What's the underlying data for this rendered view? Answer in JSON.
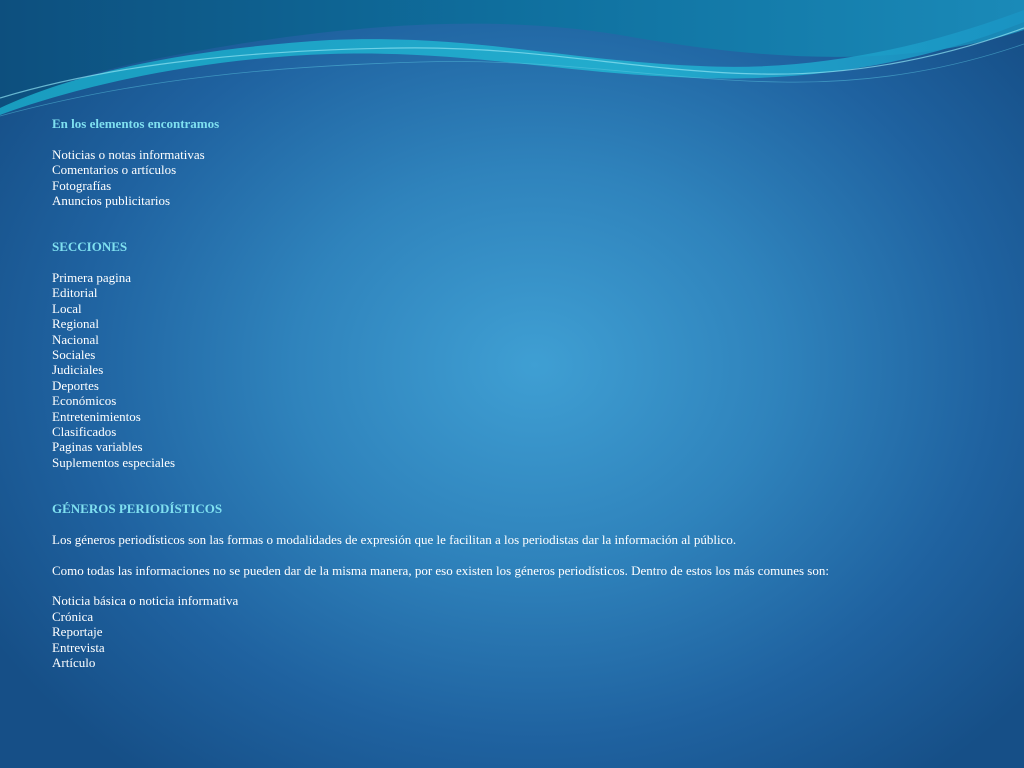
{
  "colors": {
    "background_center": "#3f9fd3",
    "background_edge": "#164f87",
    "heading": "#7fe0f0",
    "body_text": "#ffffff",
    "wave_light": "#1fa5c9",
    "wave_dark": "#0f5f8c"
  },
  "section1": {
    "heading": "En los elementos encontramos",
    "items": [
      "Noticias o notas informativas",
      "Comentarios o artículos",
      "Fotografías",
      "Anuncios publicitarios"
    ]
  },
  "section2": {
    "heading": "SECCIONES",
    "items": [
      "Primera pagina",
      "Editorial",
      "Local",
      "Regional",
      "Nacional",
      "Sociales",
      "Judiciales",
      "Deportes",
      "Económicos",
      "Entretenimientos",
      "Clasificados",
      "Paginas variables",
      "Suplementos especiales"
    ]
  },
  "section3": {
    "heading": "GÉNEROS PERIODÍSTICOS",
    "paragraph1": "Los géneros periodísticos son las formas o modalidades de expresión que le facilitan a los periodistas dar la información al público.",
    "paragraph2": "Como todas las informaciones no se pueden dar de la misma manera, por eso existen los géneros periodísticos. Dentro de estos los más comunes son:",
    "items": [
      "Noticia básica o noticia informativa",
      "Crónica",
      "Reportaje",
      "Entrevista",
      "Artículo"
    ]
  }
}
